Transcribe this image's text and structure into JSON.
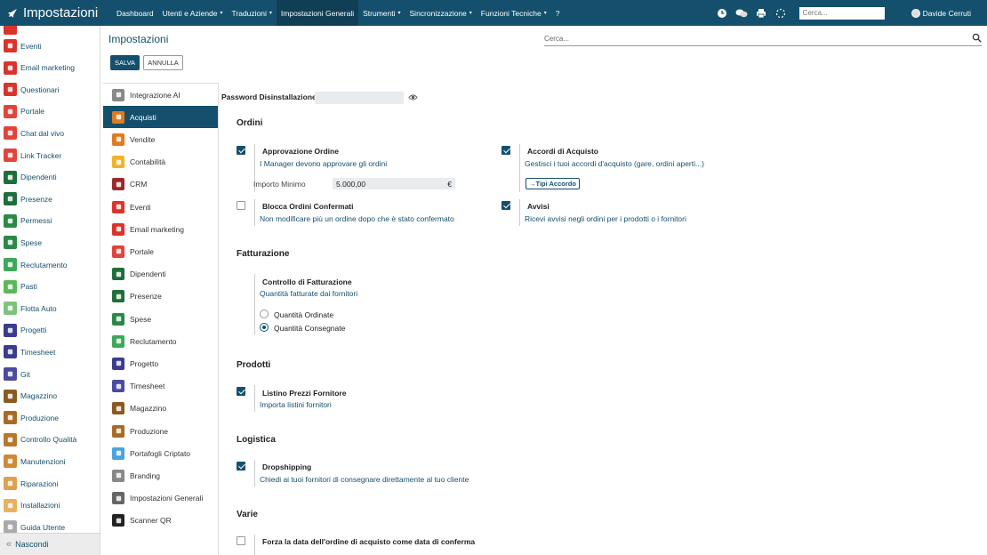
{
  "app": {
    "title": "Impostazioni"
  },
  "topmenu": [
    {
      "label": "Dashboard",
      "caret": ""
    },
    {
      "label": "Utenti e Aziende",
      "caret": "▾"
    },
    {
      "label": "Traduzioni",
      "caret": "▾"
    },
    {
      "label": "Impostazioni Generali",
      "caret": ""
    },
    {
      "label": "Strumenti",
      "caret": "▾"
    },
    {
      "label": "Sincronizzazione",
      "caret": "▾"
    },
    {
      "label": "Funzioni Tecniche",
      "caret": "▾"
    },
    {
      "label": "?",
      "caret": ""
    }
  ],
  "topbar": {
    "search_placeholder": "Cerca...",
    "user": "Davide Cerruti"
  },
  "apps": [
    {
      "label": "Eventi",
      "color": "#d9342b"
    },
    {
      "label": "Email marketing",
      "color": "#d9342b"
    },
    {
      "label": "Questionari",
      "color": "#d9342b"
    },
    {
      "label": "Portale",
      "color": "#e1443b"
    },
    {
      "label": "Chat dal vivo",
      "color": "#e1443b"
    },
    {
      "label": "Link Tracker",
      "color": "#e1443b"
    },
    {
      "label": "Dipendenti",
      "color": "#1e6e3b"
    },
    {
      "label": "Presenze",
      "color": "#1e6e3b"
    },
    {
      "label": "Permessi",
      "color": "#2a8a45"
    },
    {
      "label": "Spese",
      "color": "#2a8a45"
    },
    {
      "label": "Reclutamento",
      "color": "#3ea85a"
    },
    {
      "label": "Pasti",
      "color": "#5bb85b"
    },
    {
      "label": "Flotta Auto",
      "color": "#7cc47c"
    },
    {
      "label": "Progetti",
      "color": "#3b3b8f"
    },
    {
      "label": "Timesheet",
      "color": "#3b3b8f"
    },
    {
      "label": "Git",
      "color": "#4b4ba0"
    },
    {
      "label": "Magazzino",
      "color": "#8a5a20"
    },
    {
      "label": "Produzione",
      "color": "#a86a25"
    },
    {
      "label": "Controllo Qualità",
      "color": "#b8782c"
    },
    {
      "label": "Manutenzioni",
      "color": "#d08a35"
    },
    {
      "label": "Riparazioni",
      "color": "#e0a050"
    },
    {
      "label": "Installazioni",
      "color": "#e8b060"
    },
    {
      "label": "Guida Utente",
      "color": "#aaaaaa"
    }
  ],
  "hide_label": "Nascondi",
  "page": {
    "title": "Impostazioni",
    "search_placeholder": "Cerca...",
    "save": "SALVA",
    "cancel": "ANNULLA"
  },
  "settings_nav": [
    {
      "label": "Integrazione AI",
      "color": "#888888",
      "active": false
    },
    {
      "label": "Acquisti",
      "color": "#e07a20",
      "active": true
    },
    {
      "label": "Vendite",
      "color": "#e07a20",
      "active": false
    },
    {
      "label": "Contabilità",
      "color": "#f0b429",
      "active": false
    },
    {
      "label": "CRM",
      "color": "#9a2a2a",
      "active": false
    },
    {
      "label": "Eventi",
      "color": "#d9342b",
      "active": false
    },
    {
      "label": "Email marketing",
      "color": "#d9342b",
      "active": false
    },
    {
      "label": "Portale",
      "color": "#e1443b",
      "active": false
    },
    {
      "label": "Dipendenti",
      "color": "#1e6e3b",
      "active": false
    },
    {
      "label": "Presenze",
      "color": "#1e6e3b",
      "active": false
    },
    {
      "label": "Spese",
      "color": "#2a8a45",
      "active": false
    },
    {
      "label": "Reclutamento",
      "color": "#3ea85a",
      "active": false
    },
    {
      "label": "Progetto",
      "color": "#3b3b8f",
      "active": false
    },
    {
      "label": "Timesheet",
      "color": "#4b4ba0",
      "active": false
    },
    {
      "label": "Magazzino",
      "color": "#8a5a20",
      "active": false
    },
    {
      "label": "Produzione",
      "color": "#a86a25",
      "active": false
    },
    {
      "label": "Portafogli Criptato",
      "color": "#4aa3df",
      "active": false
    },
    {
      "label": "Branding",
      "color": "#888888",
      "active": false
    },
    {
      "label": "Impostazioni Generali",
      "color": "#666666",
      "active": false
    },
    {
      "label": "Scanner QR",
      "color": "#222222",
      "active": false
    }
  ],
  "password": {
    "label": "Password Disinstallazione"
  },
  "sections": {
    "ordini": "Ordini",
    "fatturazione": "Fatturazione",
    "prodotti": "Prodotti",
    "logistica": "Logistica",
    "varie": "Varie"
  },
  "ordini": {
    "approvazione": {
      "title": "Approvazione Ordine",
      "desc": "I Manager devono approvare gli ordini",
      "checked": true
    },
    "importo": {
      "label": "Importo Minimo",
      "value": "5.000,00",
      "currency": "€"
    },
    "accordi": {
      "title": "Accordi di Acquisto",
      "desc": "Gestisci i tuoi accordi d'acquisto (gare, ordini aperti...)",
      "checked": true,
      "link": "Tipi Accordo"
    },
    "blocca": {
      "title": "Blocca Ordini Confermati",
      "desc": "Non modificare più un ordine dopo che è stato confermato",
      "checked": false
    },
    "avvisi": {
      "title": "Avvisi",
      "desc": "Ricevi avvisi negli ordini per i prodotti o i fornitori",
      "checked": true
    }
  },
  "fatturazione": {
    "controllo": {
      "title": "Controllo di Fatturazione",
      "desc": "Quantità fatturate dai fornitori"
    },
    "options": [
      "Quantità Ordinate",
      "Quantità Consegnate"
    ],
    "selected": "Quantità Consegnate"
  },
  "prodotti": {
    "listino": {
      "title": "Listino Prezzi Fornitore",
      "desc": "Importa listini fornitori",
      "checked": true
    }
  },
  "logistica": {
    "dropshipping": {
      "title": "Dropshipping",
      "desc": "Chiedi ai tuoi fornitori di consegnare direttamente al tuo cliente",
      "checked": true
    }
  },
  "varie": {
    "forza": {
      "title": "Forza la data dell'ordine di acquisto come data di conferma",
      "checked": false
    }
  }
}
